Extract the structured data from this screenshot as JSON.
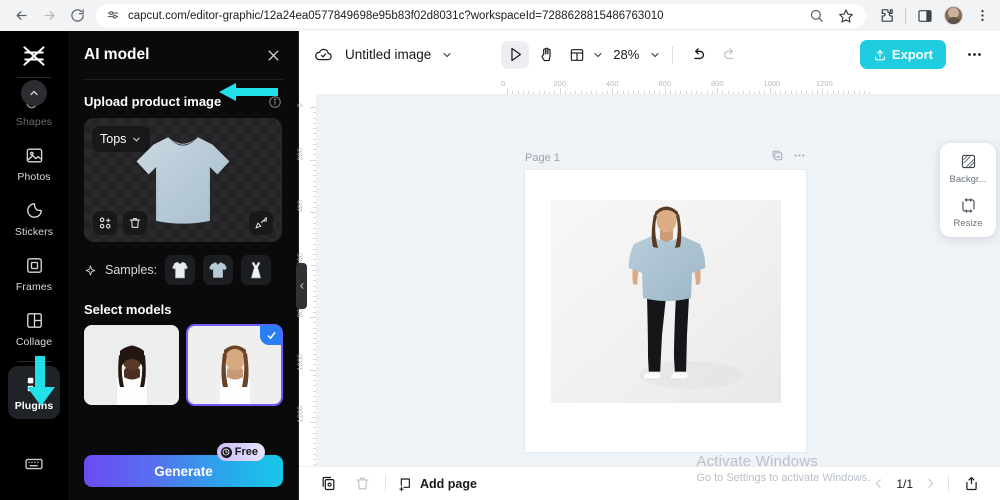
{
  "browser": {
    "url": "capcut.com/editor-graphic/12a24ea0577849698e95b83f02d8031c?workspaceId=7288628815486763010",
    "back_icon": "back-arrow-icon",
    "forward_icon": "forward-arrow-icon",
    "reload_icon": "reload-icon",
    "site_info_icon": "site-settings-icon",
    "zoom_icon": "page-zoom-icon",
    "bookmark_icon": "star-icon",
    "extensions_icon": "extensions-puzzle-icon",
    "sidepanel_icon": "side-panel-icon",
    "profile_icon": "profile-avatar",
    "menu_icon": "three-dot-menu-icon"
  },
  "rail": {
    "logo": "capcut-logo",
    "scroll_up_icon": "chevron-up-icon",
    "items": [
      {
        "label": "Shapes",
        "icon": "shapes-icon",
        "active": false
      },
      {
        "label": "Photos",
        "icon": "photos-icon",
        "active": false
      },
      {
        "label": "Stickers",
        "icon": "stickers-icon",
        "active": false
      },
      {
        "label": "Frames",
        "icon": "frames-icon",
        "active": false
      },
      {
        "label": "Collage",
        "icon": "collage-icon",
        "active": false
      },
      {
        "label": "Plugins",
        "icon": "plugins-icon",
        "active": true
      }
    ],
    "bottom_icon": "keyboard-shortcuts-icon"
  },
  "panel": {
    "title": "AI model",
    "close_icon": "close-icon",
    "upload": {
      "section_title": "Upload product image",
      "info_icon": "info-icon",
      "category_label": "Tops",
      "category_chevron_icon": "chevron-down-icon",
      "crop_icon": "crop-icon",
      "delete_icon": "trash-icon",
      "edit_icon": "magic-edit-icon"
    },
    "samples": {
      "label": "Samples:",
      "sparkle_icon": "sparkle-icon",
      "items": [
        {
          "name": "sample-shirt",
          "icon": "long-sleeve-shirt-icon"
        },
        {
          "name": "sample-tshirt",
          "icon": "tshirt-icon"
        },
        {
          "name": "sample-dress",
          "icon": "dress-icon"
        }
      ]
    },
    "models": {
      "title": "Select models",
      "items": [
        {
          "name": "model-1",
          "selected": false
        },
        {
          "name": "model-2",
          "selected": true
        }
      ],
      "check_icon": "check-icon"
    },
    "generate": {
      "label": "Generate",
      "badge": "Free",
      "badge_icon": "clock-icon"
    },
    "collapse_icon": "chevron-left-icon"
  },
  "toolbar": {
    "cloud_icon": "cloud-saved-icon",
    "doc_title": "Untitled image",
    "title_chevron_icon": "chevron-down-icon",
    "select_tool_icon": "cursor-select-icon",
    "hand_tool_icon": "hand-pan-icon",
    "layout_tool_icon": "layout-grid-icon",
    "layout_chevron_icon": "chevron-down-icon",
    "zoom_level": "28%",
    "zoom_chevron_icon": "chevron-down-icon",
    "undo_icon": "undo-icon",
    "redo_icon": "redo-icon",
    "export_label": "Export",
    "export_icon": "upload-icon",
    "more_icon": "three-dot-menu-icon"
  },
  "canvas": {
    "page_label": "Page 1",
    "duplicate_icon": "duplicate-page-icon",
    "page_menu_icon": "three-dot-menu-icon",
    "ruler_h_ticks": [
      "0",
      "200",
      "400",
      "600",
      "800",
      "1000",
      "1200"
    ],
    "ruler_v_ticks": [
      "0",
      "200",
      "400",
      "600",
      "800",
      "1000",
      "1200"
    ]
  },
  "float_card": {
    "items": [
      {
        "label": "Backgr...",
        "icon": "background-icon"
      },
      {
        "label": "Resize",
        "icon": "resize-icon"
      }
    ]
  },
  "bottombar": {
    "duplicate_icon": "duplicate-icon",
    "delete_icon": "trash-icon",
    "add_page_label": "Add page",
    "add_page_icon": "add-page-icon",
    "prev_icon": "chevron-left-icon",
    "page_count": "1/1",
    "next_icon": "chevron-right-icon",
    "present_icon": "present-icon"
  },
  "watermark": {
    "line1": "Activate Windows",
    "line2": "Go to Settings to activate Windows."
  },
  "colors": {
    "export_cyan": "#20cde0",
    "annotation_cyan": "#22e0e8",
    "generate_gradient_start": "#6a4bf2",
    "generate_gradient_end": "#17c8e8",
    "selected_outline": "#6f5bff",
    "check_badge_blue": "#2a7ef5"
  }
}
